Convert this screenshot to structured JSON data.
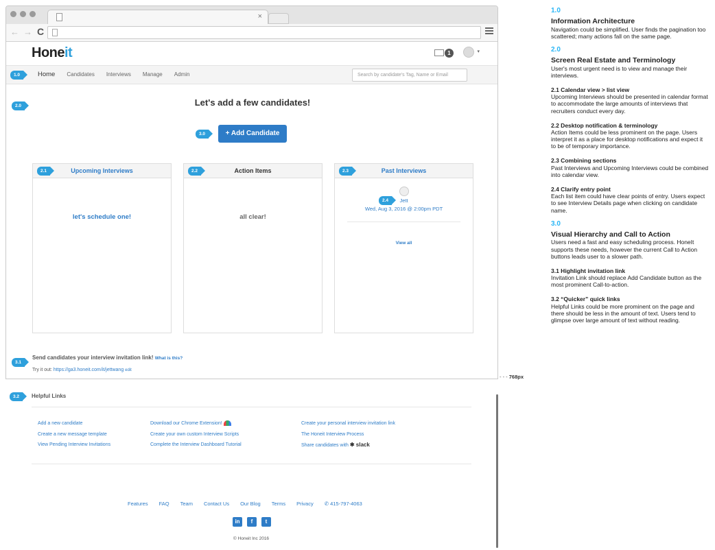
{
  "browser": {
    "tab_close": "×"
  },
  "app": {
    "logo_main": "Hone",
    "logo_accent": "it",
    "mail_count": "1",
    "avatar_caret": "▾"
  },
  "nav": {
    "items": [
      "Home",
      "Candidates",
      "Interviews",
      "Manage",
      "Admin"
    ],
    "search_placeholder": "Search by candidate's Tag, Name or Email"
  },
  "badges": {
    "b10": "1.0",
    "b20": "2.0",
    "b30": "3.0",
    "b21": "2.1",
    "b22": "2.2",
    "b23": "2.3",
    "b24": "2.4",
    "b31": "3.1",
    "b32": "3.2"
  },
  "main": {
    "headline": "Let's add a few candidates!",
    "cta_label": "+ Add Candidate"
  },
  "cards": {
    "upcoming": {
      "title": "Upcoming Interviews",
      "body": "let's schedule one!"
    },
    "actions": {
      "title": "Action Items",
      "body": "all clear!"
    },
    "past": {
      "title": "Past Interviews",
      "name": "Jett",
      "when": "Wed, Aug 3, 2016 @ 2:00pm PDT",
      "view_all": "View all"
    }
  },
  "invite": {
    "text": "Send candidates your interview invitation link!",
    "what": "What is this?",
    "try_label": "Try it out:",
    "link": "https://ga3.honeit.com/it/jettwang",
    "edit": "edit"
  },
  "fold_label": "768px",
  "helpful": {
    "title": "Helpful Links",
    "col1": [
      "Add a new candidate",
      "Create a new message template",
      "View Pending Interview Invitations"
    ],
    "col2": [
      "Download our Chrome Extension!",
      "Create your own custom Interview Scripts",
      "Complete the Interview Dashboard Tutorial"
    ],
    "col3": [
      "Create your personal interview invitation link",
      "The Honeit Interview Process",
      "Share candidates with"
    ],
    "slack": "slack"
  },
  "footer": {
    "links": [
      "Features",
      "FAQ",
      "Team",
      "Contact Us",
      "Our Blog",
      "Terms",
      "Privacy"
    ],
    "phone": "415-797-4063",
    "social": [
      "in",
      "f",
      "t"
    ],
    "copyright": "© Honeit Inc 2016"
  },
  "notes": {
    "s1": {
      "num": "1.0",
      "title": "Information Architecture",
      "body": "Navigation could be simplified. User finds the pagination too scattered; many actions fall on the same page."
    },
    "s2": {
      "num": "2.0",
      "title": "Screen Real Estate and Terminology",
      "body": "User's most urgent need is to view and manage their interviews."
    },
    "n21": {
      "title": "2.1 Calendar view > list view",
      "body": "Upcoming Interviews should be presented in calendar format to accommodate the large amounts of interviews that recruiters conduct every day."
    },
    "n22": {
      "title": "2.2 Desktop notification & terminology",
      "body": "Action Items could be less prominent on the page. Users interpret it as a place for desktop notifications and expect it to be of temporary importance."
    },
    "n23": {
      "title": "2.3 Combining sections",
      "body": "Past Interviews and Upcoming Interviews could be combined into calendar view."
    },
    "n24": {
      "title": "2.4 Clarify entry point",
      "body": "Each list item could have clear points of entry. Users expect to see Interview Details page when clicking on candidate name."
    },
    "s3": {
      "num": "3.0",
      "title": "Visual Hierarchy and Call to Action",
      "body": "Users need a fast and easy scheduling process. HoneIt supports these needs, however the current Call to Action buttons leads user to a slower path."
    },
    "n31": {
      "title": "3.1 Highlight invitation link",
      "body": "Invitation Link should replace Add Candidate button as the most prominent Call-to-action."
    },
    "n32": {
      "title": "3.2 “Quicker” quick links",
      "body": "Helpful Links could be more prominent on the page and there should be less in the amount of text. Users tend to glimpse over large amount of text without reading."
    }
  }
}
